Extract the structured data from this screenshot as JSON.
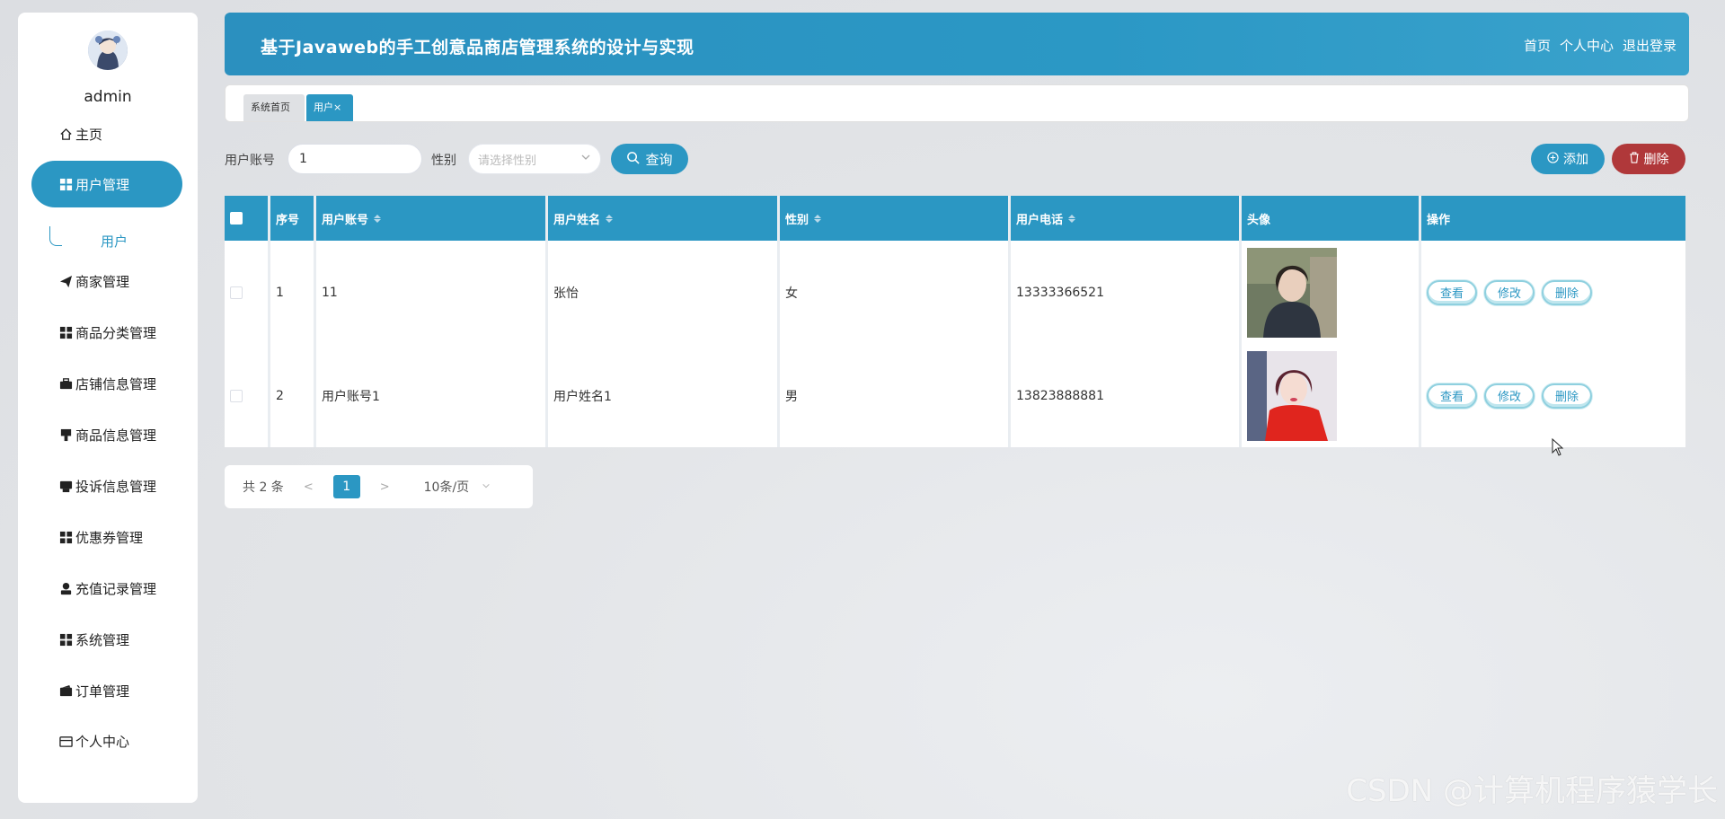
{
  "user": {
    "name": "admin"
  },
  "sidebar": {
    "items": [
      {
        "label": "主页",
        "icon": "home-icon"
      },
      {
        "label": "用户管理",
        "icon": "grid-icon",
        "active": true
      },
      {
        "label": "商家管理",
        "icon": "paper-plane-icon"
      },
      {
        "label": "商品分类管理",
        "icon": "grid-icon"
      },
      {
        "label": "店铺信息管理",
        "icon": "briefcase-icon"
      },
      {
        "label": "商品信息管理",
        "icon": "flag-icon"
      },
      {
        "label": "投诉信息管理",
        "icon": "printer-icon"
      },
      {
        "label": "优惠券管理",
        "icon": "grid-icon"
      },
      {
        "label": "充值记录管理",
        "icon": "person-icon"
      },
      {
        "label": "系统管理",
        "icon": "grid-icon"
      },
      {
        "label": "订单管理",
        "icon": "wallet-icon"
      },
      {
        "label": "个人中心",
        "icon": "card-icon"
      }
    ],
    "sub_item": "用户"
  },
  "header": {
    "title": "基于Javaweb的手工创意品商店管理系统的设计与实现",
    "links": [
      "首页",
      "个人中心",
      "退出登录"
    ]
  },
  "tabs": {
    "home": "系统首页",
    "user": "用户",
    "close": "×"
  },
  "search": {
    "account_label": "用户账号",
    "account_value": "1",
    "gender_label": "性别",
    "gender_placeholder": "请选择性别",
    "query_button": "查询",
    "add_button": "添加",
    "delete_button": "删除"
  },
  "table": {
    "headers": [
      "序号",
      "用户账号",
      "用户姓名",
      "性别",
      "用户电话",
      "头像",
      "操作"
    ],
    "rows": [
      {
        "index": "1",
        "account": "11",
        "name": "张怡",
        "gender": "女",
        "phone": "13333366521"
      },
      {
        "index": "2",
        "account": "用户账号1",
        "name": "用户姓名1",
        "gender": "男",
        "phone": "13823888881"
      }
    ],
    "actions": {
      "view": "查看",
      "edit": "修改",
      "delete": "删除"
    }
  },
  "pagination": {
    "total": "共 2 条",
    "prev": "<",
    "current": "1",
    "next": ">",
    "page_size": "10条/页"
  },
  "watermark": "CSDN @计算机程序猿学长",
  "colors": {
    "primary": "#2b97c3",
    "danger": "#b0383a"
  }
}
